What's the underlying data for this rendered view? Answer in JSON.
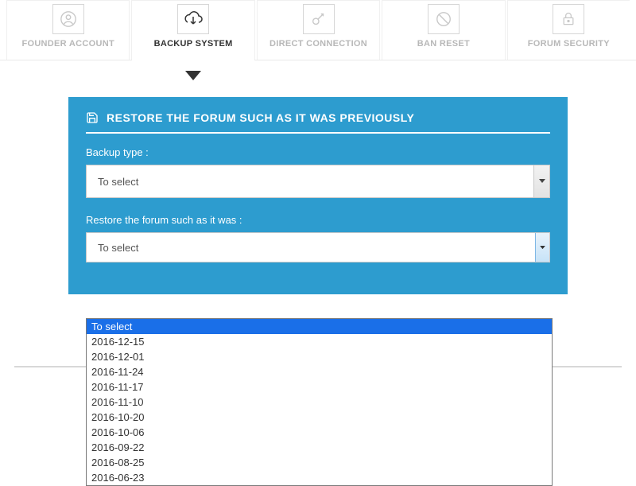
{
  "tabs": {
    "founder": "FOUNDER ACCOUNT",
    "backup": "BACKUP SYSTEM",
    "direct": "DIRECT CONNECTION",
    "ban": "BAN RESET",
    "security": "FORUM SECURITY"
  },
  "panel": {
    "title": "RESTORE THE FORUM SUCH AS IT WAS PREVIOUSLY",
    "backup_type_label": "Backup type :",
    "backup_type_value": "To select",
    "restore_label": "Restore the forum such as it was :",
    "restore_value": "To select"
  },
  "dropdown": {
    "options": [
      "To select",
      "2016-12-15",
      "2016-12-01",
      "2016-11-24",
      "2016-11-17",
      "2016-11-10",
      "2016-10-20",
      "2016-10-06",
      "2016-09-22",
      "2016-08-25",
      "2016-06-23"
    ]
  }
}
